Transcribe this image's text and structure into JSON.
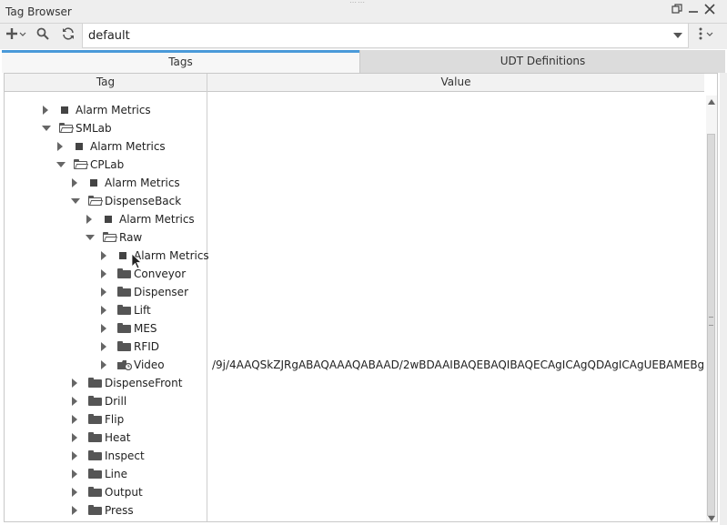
{
  "window": {
    "title": "Tag Browser",
    "restore_icon": "restore-icon",
    "minimize_icon": "minimize-icon",
    "close_icon": "close-icon"
  },
  "toolbar": {
    "add_icon": "plus-icon",
    "search_icon": "search-icon",
    "refresh_icon": "refresh-icon",
    "menu_icon": "kebab-menu-icon",
    "provider_value": "default"
  },
  "tabs": [
    {
      "label": "Tags",
      "active": true
    },
    {
      "label": "UDT Definitions",
      "active": false
    }
  ],
  "table": {
    "columns": [
      "Tag",
      "Value"
    ],
    "rows": [
      {
        "label": "Alarm Metrics",
        "icon": "tag",
        "expanded": false
      },
      {
        "label": "SMLab",
        "icon": "folder-open",
        "expanded": true
      },
      {
        "label": "Alarm Metrics",
        "icon": "tag",
        "expanded": false
      },
      {
        "label": "CPLab",
        "icon": "folder-open",
        "expanded": true
      },
      {
        "label": "Alarm Metrics",
        "icon": "tag",
        "expanded": false
      },
      {
        "label": "DispenseBack",
        "icon": "folder-open",
        "expanded": true
      },
      {
        "label": "Alarm Metrics",
        "icon": "tag",
        "expanded": false
      },
      {
        "label": "Raw",
        "icon": "folder-open",
        "expanded": true
      },
      {
        "label": "Alarm Metrics",
        "icon": "tag",
        "expanded": false
      },
      {
        "label": "Conveyor",
        "icon": "folder",
        "expanded": false
      },
      {
        "label": "Dispenser",
        "icon": "folder",
        "expanded": false
      },
      {
        "label": "Lift",
        "icon": "folder",
        "expanded": false
      },
      {
        "label": "MES",
        "icon": "folder",
        "expanded": false
      },
      {
        "label": "RFID",
        "icon": "folder",
        "expanded": false
      },
      {
        "label": "Video",
        "icon": "udt",
        "expanded": false
      },
      {
        "label": "DispenseFront",
        "icon": "folder",
        "expanded": false
      },
      {
        "label": "Drill",
        "icon": "folder",
        "expanded": false
      },
      {
        "label": "Flip",
        "icon": "folder",
        "expanded": false
      },
      {
        "label": "Heat",
        "icon": "folder",
        "expanded": false
      },
      {
        "label": "Inspect",
        "icon": "folder",
        "expanded": false
      },
      {
        "label": "Line",
        "icon": "folder",
        "expanded": false
      },
      {
        "label": "Output",
        "icon": "folder",
        "expanded": false
      },
      {
        "label": "Press",
        "icon": "folder",
        "expanded": false
      }
    ],
    "video_value": "/9j/4AAQSkZJRgABAQAAAQABAAD/2wBDAAIBAQEBAQIBAQECAgICAgQDAgICAgUEBAMEBgU..."
  }
}
